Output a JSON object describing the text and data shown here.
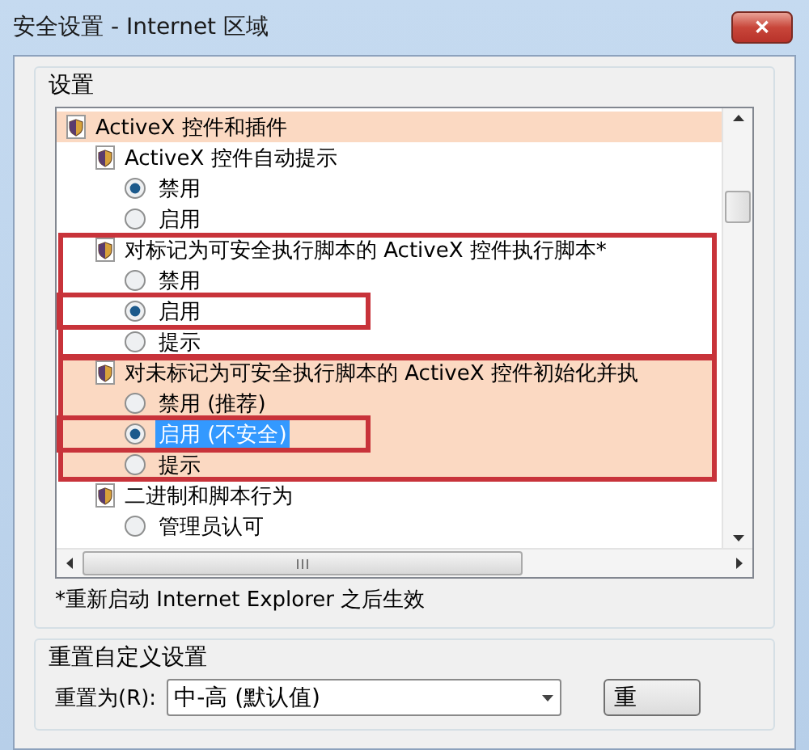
{
  "window": {
    "title": "安全设置 - Internet 区域",
    "close": "✕"
  },
  "settings_group": {
    "title": "设置",
    "list": [
      {
        "kind": "category",
        "label": "ActiveX 控件和插件",
        "highlighted": true,
        "children": [
          {
            "kind": "setting",
            "label": "ActiveX 控件自动提示",
            "shaded": false,
            "outlined": false,
            "options": [
              {
                "label": "禁用",
                "selected": true,
                "outlined": false,
                "focused": false
              },
              {
                "label": "启用",
                "selected": false,
                "outlined": false,
                "focused": false
              }
            ]
          },
          {
            "kind": "setting",
            "label": "对标记为可安全执行脚本的 ActiveX 控件执行脚本*",
            "shaded": false,
            "outlined": true,
            "options": [
              {
                "label": "禁用",
                "selected": false,
                "outlined": false,
                "focused": false
              },
              {
                "label": "启用",
                "selected": true,
                "outlined": true,
                "focused": false
              },
              {
                "label": "提示",
                "selected": false,
                "outlined": false,
                "focused": false
              }
            ]
          },
          {
            "kind": "setting",
            "label": "对未标记为可安全执行脚本的 ActiveX 控件初始化并执",
            "shaded": true,
            "outlined": true,
            "options": [
              {
                "label": "禁用 (推荐)",
                "selected": false,
                "outlined": false,
                "focused": false
              },
              {
                "label": "启用 (不安全)",
                "selected": true,
                "outlined": true,
                "focused": true
              },
              {
                "label": "提示",
                "selected": false,
                "outlined": false,
                "focused": false
              }
            ]
          },
          {
            "kind": "setting",
            "label": "二进制和脚本行为",
            "shaded": false,
            "outlined": false,
            "options": [
              {
                "label": "管理员认可",
                "selected": false,
                "outlined": false,
                "focused": false
              }
            ]
          }
        ]
      }
    ],
    "note": "*重新启动 Internet Explorer 之后生效"
  },
  "reset_group": {
    "title": "重置自定义设置",
    "label": "重置为(R):",
    "value": "中-高 (默认值)",
    "button": "重"
  }
}
